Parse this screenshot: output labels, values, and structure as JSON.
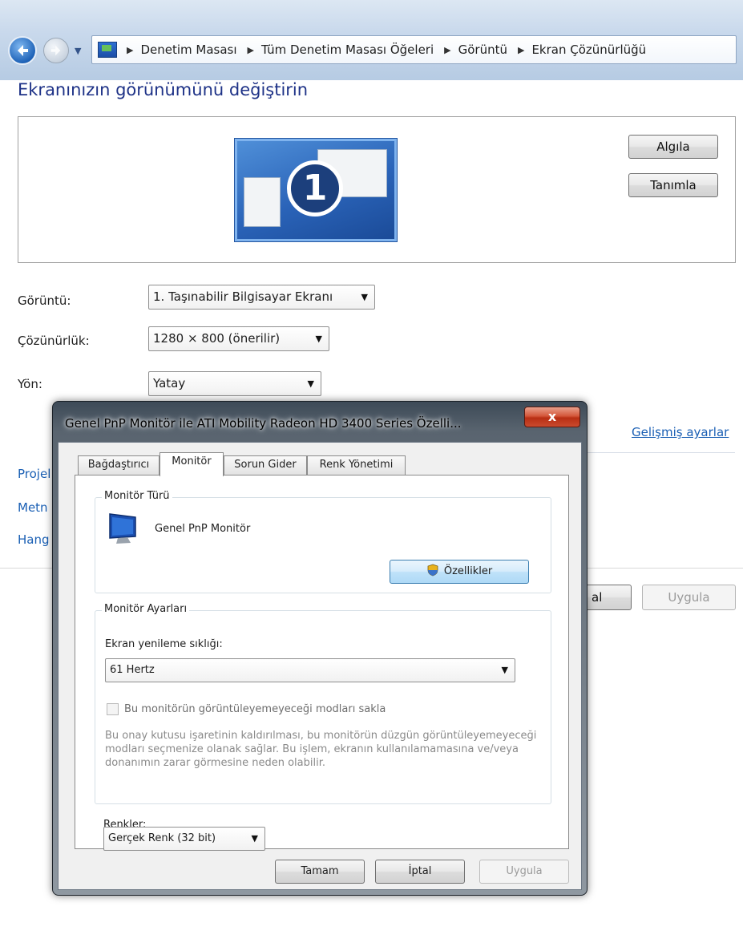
{
  "breadcrumb": [
    "Denetim Masası",
    "Tüm Denetim Masası Öğeleri",
    "Görüntü",
    "Ekran Çözünürlüğü"
  ],
  "page_title": "Ekranınızın görünümünü değiştirin",
  "preview": {
    "monitor_number": "1",
    "detect_button": "Algıla",
    "identify_button": "Tanımla"
  },
  "fields": {
    "display_label": "Görüntü:",
    "display_value": "1. Taşınabilir Bilgisayar Ekranı",
    "resolution_label": "Çözünürlük:",
    "resolution_value": "1280 × 800 (önerilir)",
    "orientation_label": "Yön:",
    "orientation_value": "Yatay"
  },
  "advanced_link": "Gelişmiş ayarlar",
  "side_links": [
    "Projel",
    "Metn",
    "Hang"
  ],
  "page_buttons": {
    "cancel_partial": "al",
    "apply": "Uygula"
  },
  "dialog": {
    "title": "Genel PnP Monitör ile ATI Mobility Radeon HD 3400 Series Özelli...",
    "close": "x",
    "tabs": [
      "Bağdaştırıcı",
      "Monitör",
      "Sorun Gider",
      "Renk Yönetimi"
    ],
    "active_tab": "Monitör",
    "monitor_type": {
      "group_label": "Monitör Türü",
      "monitor_name": "Genel PnP Monitör",
      "properties_button": "Özellikler"
    },
    "monitor_settings": {
      "group_label": "Monitör Ayarları",
      "refresh_label": "Ekran yenileme sıklığı:",
      "refresh_value": "61 Hertz",
      "hide_modes_label": "Bu monitörün görüntüleyemeyeceği modları sakla",
      "description": "Bu onay kutusu işaretinin kaldırılması, bu monitörün düzgün görüntüleyemeyeceği modları seçmenize olanak sağlar. Bu işlem, ekranın kullanılamamasına ve/veya donanımın zarar görmesine neden olabilir."
    },
    "colors_label": "Renkler:",
    "colors_value": "Gerçek Renk (32 bit)",
    "buttons": {
      "ok": "Tamam",
      "cancel": "İptal",
      "apply": "Uygula"
    }
  },
  "colors": {
    "title_blue": "#1e3287",
    "link_blue": "#1a5fb4",
    "close_red": "#c94a2e"
  }
}
